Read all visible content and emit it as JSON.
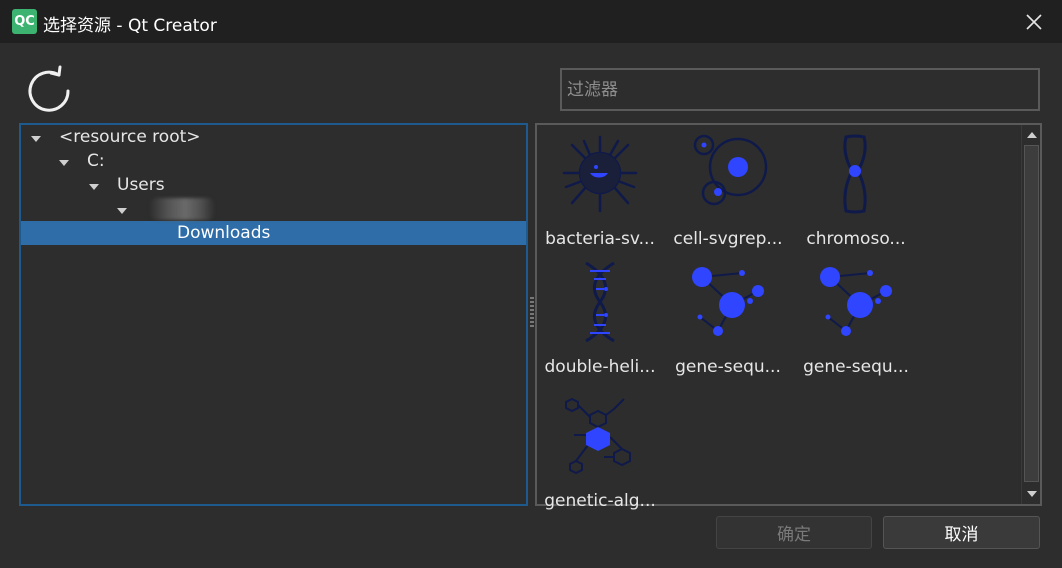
{
  "window": {
    "app_logo": "QC",
    "title": "选择资源 - Qt Creator"
  },
  "toolbar": {
    "refresh_icon": "refresh-icon"
  },
  "filter": {
    "placeholder": "过滤器",
    "value": ""
  },
  "tree": {
    "items": [
      {
        "label": "<resource root>",
        "expanded": true
      },
      {
        "label": "C:",
        "expanded": true
      },
      {
        "label": "Users",
        "expanded": true
      },
      {
        "label": "",
        "expanded": true,
        "redacted": true
      },
      {
        "label": "Downloads",
        "selected": true
      }
    ]
  },
  "resources": {
    "items": [
      {
        "label": "bacteria-sv...",
        "icon": "bacteria-icon"
      },
      {
        "label": "cell-svgrep...",
        "icon": "cell-icon"
      },
      {
        "label": "chromoso...",
        "icon": "chromosome-icon"
      },
      {
        "label": "double-heli...",
        "icon": "double-helix-icon"
      },
      {
        "label": "gene-sequ...",
        "icon": "gene-sequence-icon"
      },
      {
        "label": "gene-sequ...",
        "icon": "gene-sequence-icon"
      },
      {
        "label": "genetic-alg...",
        "icon": "genetic-algorithm-icon"
      }
    ]
  },
  "buttons": {
    "ok_label": "确定",
    "cancel_label": "取消"
  },
  "colors": {
    "accent_selected": "#2e6da8",
    "icon_blue": "#2f45ff",
    "icon_dark": "#0f1a4a",
    "title_bar": "#202020"
  }
}
